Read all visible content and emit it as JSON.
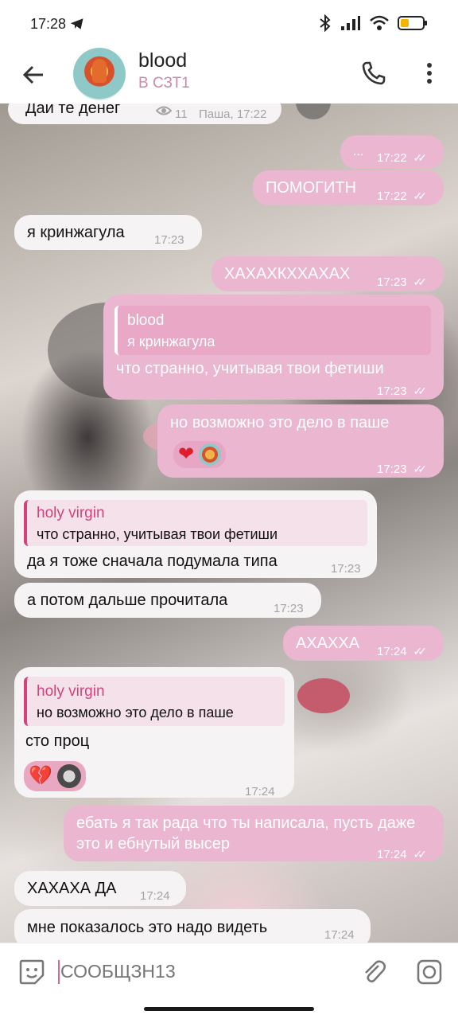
{
  "status_bar": {
    "time": "17:28",
    "icons": [
      "telegram-icon",
      "bluetooth-icon",
      "signal-icon",
      "wifi-icon",
      "battery-icon"
    ]
  },
  "header": {
    "title": "blood",
    "subtitle": "В СЗТ1",
    "icons": [
      "back-arrow-icon",
      "phone-icon",
      "more-vert-icon"
    ]
  },
  "messages": [
    {
      "id": "m0",
      "dir": "in",
      "text": "Дай те денег",
      "views": "11",
      "author_time": "Паша, 17:22"
    },
    {
      "id": "m1",
      "dir": "out",
      "text": "...",
      "time": "17:22"
    },
    {
      "id": "m2",
      "dir": "out",
      "text": "ПОМОГИТН",
      "time": "17:22"
    },
    {
      "id": "m3",
      "dir": "in",
      "text": "я кринжагула",
      "time": "17:23"
    },
    {
      "id": "m4",
      "dir": "out",
      "text": "ХАХАХКХХАХАХ",
      "time": "17:23"
    },
    {
      "id": "m5",
      "dir": "out",
      "reply_name": "blood",
      "reply_text": "я кринжагула",
      "text": "что странно, учитывая твои фетиши",
      "time": "17:23"
    },
    {
      "id": "m6",
      "dir": "out",
      "text": "но возможно это дело в паше",
      "time": "17:23",
      "reactions": [
        "heart-emoji",
        "avatar"
      ]
    },
    {
      "id": "m7",
      "dir": "in",
      "reply_name": "holy virgin",
      "reply_text": "что странно, учитывая твои фетиши",
      "text": "да я тоже сначала подумала типа",
      "time": "17:23"
    },
    {
      "id": "m8",
      "dir": "in",
      "text": "а потом дальше прочитала",
      "time": "17:23"
    },
    {
      "id": "m9",
      "dir": "out",
      "text": "АХАХХА",
      "time": "17:24"
    },
    {
      "id": "m10",
      "dir": "in",
      "reply_name": "holy virgin",
      "reply_text": "но возможно это дело в паше",
      "text": "сто проц",
      "time": "17:24",
      "reactions": [
        "broken-heart-emoji",
        "avatar"
      ]
    },
    {
      "id": "m11",
      "dir": "out",
      "text": "ебать я так рада что ты написала, пусть даже это и ебнутый высер",
      "time": "17:24"
    },
    {
      "id": "m12",
      "dir": "in",
      "text": "ХАХАХА ДА",
      "time": "17:24"
    },
    {
      "id": "m13",
      "dir": "in",
      "text": "мне показалось это надо видеть",
      "time": "17:24"
    }
  ],
  "input": {
    "placeholder": "СООБЩЗН13"
  },
  "colors": {
    "outgoing": "#ebb6cf",
    "incoming": "#f6f3f4",
    "accent": "#d3437b"
  }
}
